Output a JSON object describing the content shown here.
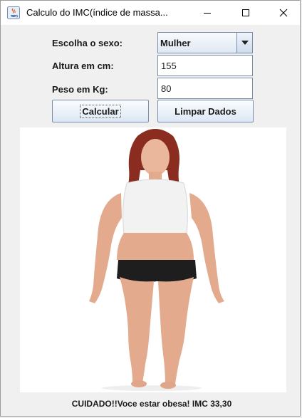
{
  "window": {
    "title": "Calculo do IMC(índice de massa...",
    "icon": "java-app-icon",
    "controls": [
      "minimize-icon",
      "maximize-icon",
      "close-icon"
    ]
  },
  "form": {
    "sex_label": "Escolha o sexo:",
    "sex_value": "Mulher",
    "height_label": "Altura em cm:",
    "height_value": "155",
    "weight_label": "Peso em Kg:",
    "weight_value": "80"
  },
  "buttons": {
    "calculate": "Calcular",
    "clear": "Limpar Dados"
  },
  "image": {
    "subject": "woman-figure-illustration"
  },
  "result": {
    "message": "CUIDADO!!Voce estar obesa! IMC 33,30"
  },
  "colors": {
    "window_bg": "#f0f0f0",
    "control_border": "#7a8ea8",
    "button_gradient_top": "#fbfdff",
    "button_gradient_bottom": "#dce7f4"
  }
}
